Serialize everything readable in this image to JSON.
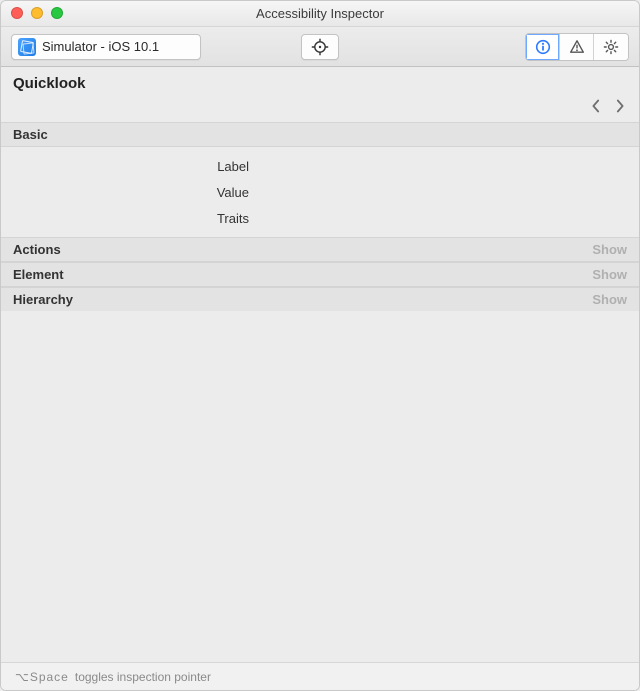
{
  "window": {
    "title": "Accessibility Inspector"
  },
  "toolbar": {
    "target_label": "Simulator - iOS 10.1",
    "icons": {
      "crosshair": "crosshair-icon",
      "info": "info-icon",
      "warning": "warning-icon",
      "gear": "gear-icon"
    }
  },
  "quicklook": {
    "title": "Quicklook"
  },
  "sections": {
    "basic": {
      "title": "Basic",
      "rows": [
        {
          "label": "Label",
          "value": ""
        },
        {
          "label": "Value",
          "value": ""
        },
        {
          "label": "Traits",
          "value": ""
        }
      ]
    },
    "actions": {
      "title": "Actions",
      "show_label": "Show"
    },
    "element": {
      "title": "Element",
      "show_label": "Show"
    },
    "hierarchy": {
      "title": "Hierarchy",
      "show_label": "Show"
    }
  },
  "footer": {
    "hint_prefix": "⌥Space",
    "hint_text": "toggles inspection pointer"
  },
  "colors": {
    "accent": "#2f7bff"
  }
}
